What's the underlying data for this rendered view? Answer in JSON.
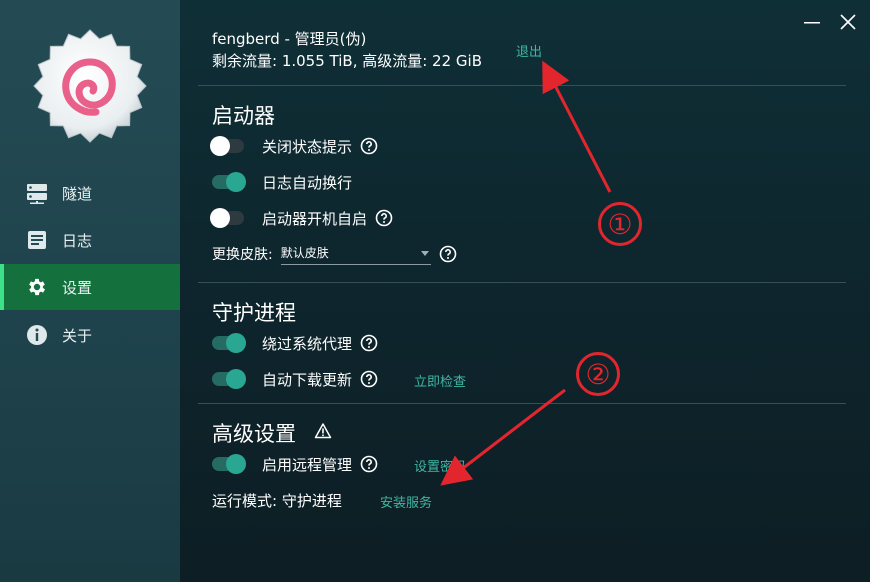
{
  "window": {
    "minimize_icon": "minimize-icon",
    "close_icon": "close-icon"
  },
  "sidebar": {
    "items": [
      {
        "label": "隧道",
        "icon": "server-icon",
        "active": false
      },
      {
        "label": "日志",
        "icon": "document-icon",
        "active": false
      },
      {
        "label": "设置",
        "icon": "gear-icon",
        "active": true
      },
      {
        "label": "关于",
        "icon": "info-icon",
        "active": false
      }
    ]
  },
  "user": {
    "name": "fengberd - 管理员(伪)",
    "traffic": "剩余流量: 1.055 TiB, 高级流量: 22 GiB",
    "logout_label": "退出"
  },
  "launcher": {
    "title": "启动器",
    "options": [
      {
        "label": "关闭状态提示",
        "enabled": false,
        "help": true
      },
      {
        "label": "日志自动换行",
        "enabled": true,
        "help": false
      },
      {
        "label": "启动器开机自启",
        "enabled": false,
        "help": true
      }
    ],
    "skin_label": "更换皮肤:",
    "skin_value": "默认皮肤"
  },
  "daemon": {
    "title": "守护进程",
    "options": [
      {
        "label": "绕过系统代理",
        "enabled": true,
        "help": true
      },
      {
        "label": "自动下载更新",
        "enabled": true,
        "help": true,
        "link": "立即检查"
      }
    ]
  },
  "advanced": {
    "title": "高级设置",
    "warning_icon": "warning-icon",
    "options": [
      {
        "label": "启用远程管理",
        "enabled": true,
        "help": true,
        "link": "设置密码"
      }
    ],
    "mode_label": "运行模式: 守护进程",
    "install_label": "安装服务"
  },
  "annotations": {
    "one": "①",
    "two": "②"
  },
  "colors": {
    "accent": "#3fb7a4",
    "active_nav": "#14703d",
    "annotation": "#e3262d"
  }
}
